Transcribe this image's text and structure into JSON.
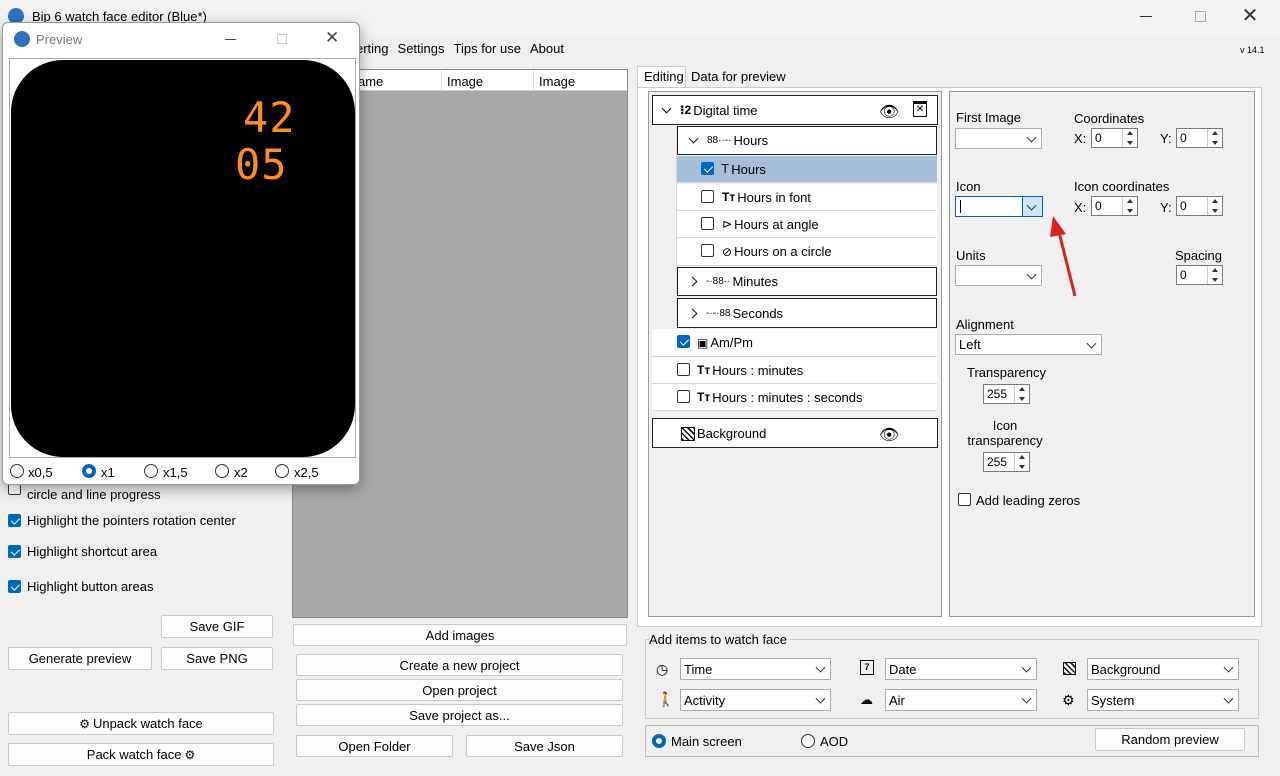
{
  "window": {
    "title": "Bip 6 watch face editor (Blue*)",
    "version": "v 14.1"
  },
  "menu": {
    "items": [
      "erting",
      "Settings",
      "Tips for use",
      "About"
    ]
  },
  "images_table": {
    "columns": [
      "ame",
      "Image",
      "Image"
    ]
  },
  "preview": {
    "title": "Preview",
    "time_top": "42",
    "time_bottom": "05",
    "time_color": "#ff8c1a",
    "scales": [
      "x0,5",
      "x1",
      "x1,5",
      "x2",
      "x2,5"
    ],
    "selected_scale": "x1"
  },
  "left_options": {
    "partial_label": "circle and line progress",
    "items": [
      {
        "label": "Highlight the pointers rotation center",
        "checked": true
      },
      {
        "label": "Highlight shortcut area",
        "checked": true
      },
      {
        "label": "Highlight button areas",
        "checked": true
      }
    ],
    "save_gif": "Save GIF",
    "generate_preview": "Generate preview",
    "save_png": "Save PNG",
    "unpack": "Unpack watch face",
    "pack": "Pack watch face"
  },
  "middle": {
    "add_images": "Add images",
    "create_project": "Create a new project",
    "open_project": "Open project",
    "save_project_as": "Save project as...",
    "open_folder": "Open Folder",
    "save_json": "Save Json"
  },
  "tabs": {
    "editing": "Editing",
    "data_for_preview": "Data for preview"
  },
  "tree": {
    "digital_time": "Digital time",
    "hours_group": "Hours",
    "hours": "Hours",
    "hours_in_font": "Hours in font",
    "hours_at_angle": "Hours at angle",
    "hours_on_circle": "Hours on a circle",
    "minutes": "Minutes",
    "seconds": "Seconds",
    "am_pm": "Am/Pm",
    "hours_minutes": "Hours : minutes",
    "hours_minutes_seconds": "Hours : minutes : seconds",
    "background": "Background"
  },
  "props": {
    "first_image": "First Image",
    "coordinates": "Coordinates",
    "x_label": "X:",
    "y_label": "Y:",
    "coord_x": "0",
    "coord_y": "0",
    "icon": "Icon",
    "icon_coordinates": "Icon coordinates",
    "icon_x": "0",
    "icon_y": "0",
    "units": "Units",
    "spacing": "Spacing",
    "spacing_value": "0",
    "alignment": "Alignment",
    "alignment_value": "Left",
    "transparency": "Transparency",
    "transparency_value": "255",
    "icon_transparency": "Icon transparency",
    "icon_transparency_value": "255",
    "add_leading_zeros": "Add leading zeros"
  },
  "add_items": {
    "legend": "Add items to watch face",
    "time": "Time",
    "date": "Date",
    "background": "Background",
    "activity": "Activity",
    "air": "Air",
    "system": "System"
  },
  "screen_mode": {
    "main_screen": "Main screen",
    "aod": "AOD",
    "random_preview": "Random preview"
  },
  "annotation_color": "#e02020"
}
